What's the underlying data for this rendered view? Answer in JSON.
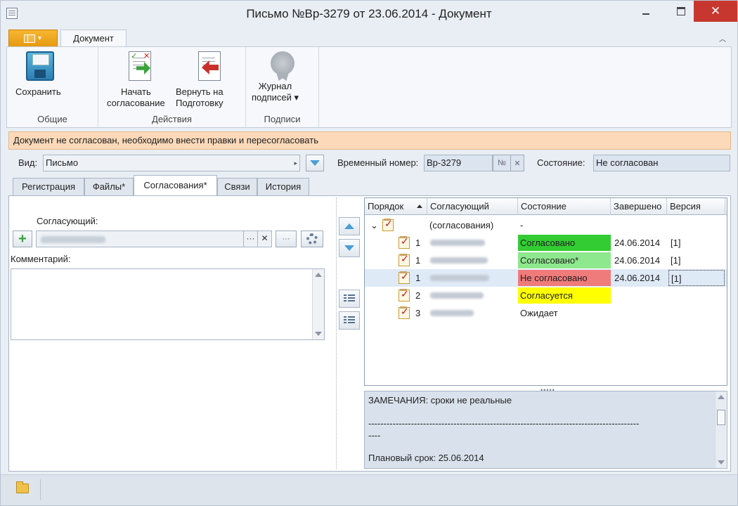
{
  "window": {
    "title": "Письмо №Вр-3279 от 23.06.2014 - Документ"
  },
  "ribbon": {
    "tab_label": "Документ",
    "groups": [
      {
        "caption": "Общие",
        "buttons": [
          {
            "label": "Сохранить",
            "icon": "save-icon"
          }
        ]
      },
      {
        "caption": "Действия",
        "buttons": [
          {
            "label": "Начать\nсогласование",
            "icon": "start-approval-icon"
          },
          {
            "label": "Вернуть на\nПодготовку",
            "icon": "return-icon"
          }
        ]
      },
      {
        "caption": "Подписи",
        "buttons": [
          {
            "label": "Журнал\nподписей ▾",
            "icon": "signature-journal-icon",
            "disabled": true
          }
        ]
      }
    ]
  },
  "banner": {
    "text": "Документ не согласован, необходимо внести правки и пересогласовать"
  },
  "fields": {
    "type_label": "Вид:",
    "type_value": "Письмо",
    "temp_number_label": "Временный номер:",
    "temp_number_value": "Вр-3279",
    "number_sign": "№",
    "clear_sign": "✕",
    "state_label": "Состояние:",
    "state_value": "Не согласован"
  },
  "tabs": [
    "Регистрация",
    "Файлы*",
    "Согласования*",
    "Связи",
    "История"
  ],
  "left_pane": {
    "approver_label": "Согласующий:",
    "comment_label": "Комментарий:",
    "ellipsis": "···",
    "clear": "✕",
    "more": "···"
  },
  "grid": {
    "columns": [
      "Порядок",
      "Согласующий",
      "Состояние",
      "Завершено",
      "Версия"
    ],
    "group_row": {
      "expander": "⌄",
      "approver": "(согласования)",
      "state": "-"
    },
    "rows": [
      {
        "order": "1",
        "state": "Согласовано",
        "state_color": "#33cc33",
        "completed": "24.06.2014",
        "version": "[1]"
      },
      {
        "order": "1",
        "state": "Согласовано*",
        "state_color": "#8ee88e",
        "completed": "24.06.2014",
        "version": "[1]"
      },
      {
        "order": "1",
        "state": "Не согласовано",
        "state_color": "#ef7b7b",
        "completed": "24.06.2014",
        "version": "[1]",
        "selected": true
      },
      {
        "order": "2",
        "state": "Согласуется",
        "state_color": "#ffff00",
        "completed": "",
        "version": ""
      },
      {
        "order": "3",
        "state": "Ожидает",
        "state_color": "",
        "completed": "",
        "version": ""
      }
    ]
  },
  "notes": {
    "line1": "ЗАМЕЧАНИЯ: сроки не реальные",
    "line2": "-----------------------------------------------------------------------------------------",
    "line3": "----",
    "line4": "Плановый срок: 25.06.2014"
  }
}
